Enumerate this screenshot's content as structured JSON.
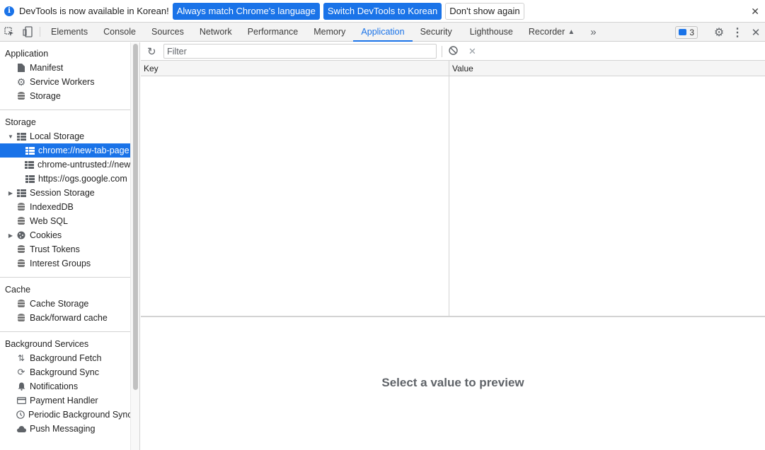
{
  "infobar": {
    "message": "DevTools is now available in Korean!",
    "btn_match": "Always match Chrome's language",
    "btn_switch": "Switch DevTools to Korean",
    "btn_dismiss": "Don't show again"
  },
  "tabs": [
    "Elements",
    "Console",
    "Sources",
    "Network",
    "Performance",
    "Memory",
    "Application",
    "Security",
    "Lighthouse",
    "Recorder"
  ],
  "active_tab": "Application",
  "issues_count": "3",
  "sidebar": {
    "application": {
      "title": "Application",
      "items": [
        "Manifest",
        "Service Workers",
        "Storage"
      ]
    },
    "storage": {
      "title": "Storage",
      "local_storage": "Local Storage",
      "local_children": [
        "chrome://new-tab-page",
        "chrome-untrusted://new-tab-page",
        "https://ogs.google.com"
      ],
      "session_storage": "Session Storage",
      "indexeddb": "IndexedDB",
      "websql": "Web SQL",
      "cookies": "Cookies",
      "trust_tokens": "Trust Tokens",
      "interest_groups": "Interest Groups"
    },
    "cache": {
      "title": "Cache",
      "items": [
        "Cache Storage",
        "Back/forward cache"
      ]
    },
    "background": {
      "title": "Background Services",
      "items": [
        "Background Fetch",
        "Background Sync",
        "Notifications",
        "Payment Handler",
        "Periodic Background Sync",
        "Push Messaging"
      ]
    }
  },
  "main": {
    "filter_placeholder": "Filter",
    "col_key": "Key",
    "col_value": "Value",
    "preview_text": "Select a value to preview"
  },
  "colors": {
    "accent": "#1a73e8"
  }
}
